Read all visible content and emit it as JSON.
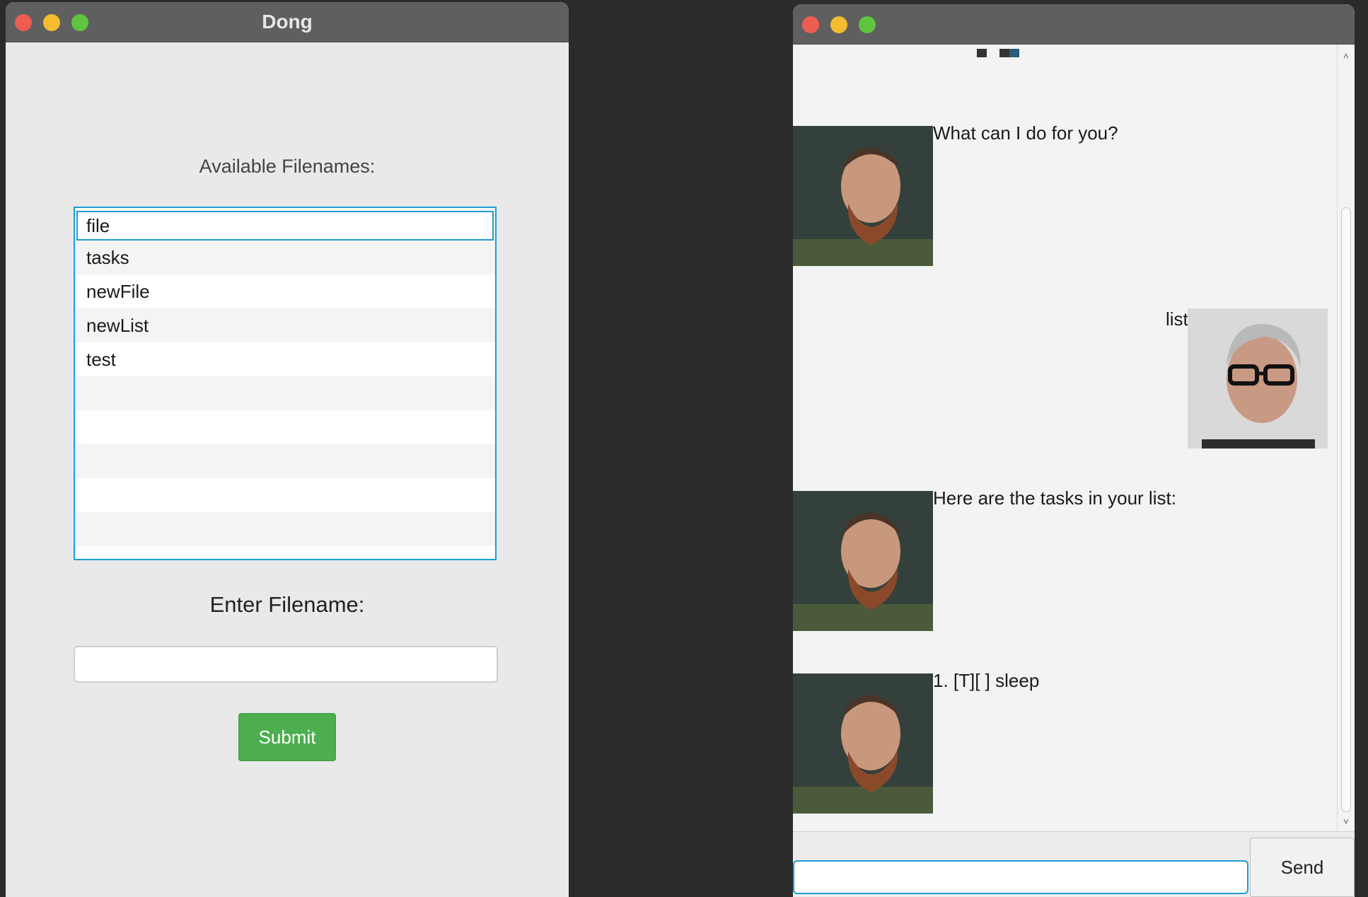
{
  "filename_window": {
    "title": "Dong",
    "available_label": "Available Filenames:",
    "filenames": [
      "file",
      "tasks",
      "newFile",
      "newList",
      "test"
    ],
    "selected_index": 0,
    "enter_label": "Enter Filename:",
    "filename_input_value": "",
    "submit_label": "Submit"
  },
  "chat_window": {
    "title": "",
    "messages": [
      {
        "sender": "bot",
        "text": "What can I do for you?"
      },
      {
        "sender": "user",
        "text": "list"
      },
      {
        "sender": "bot",
        "text": "Here are the tasks in your list:"
      },
      {
        "sender": "bot",
        "text": "1. [T][ ] sleep"
      }
    ],
    "input_value": "",
    "send_label": "Send"
  },
  "colors": {
    "accent": "#1f9bd6",
    "submit": "#4cae4f",
    "titlebar": "#5f5f5f"
  }
}
